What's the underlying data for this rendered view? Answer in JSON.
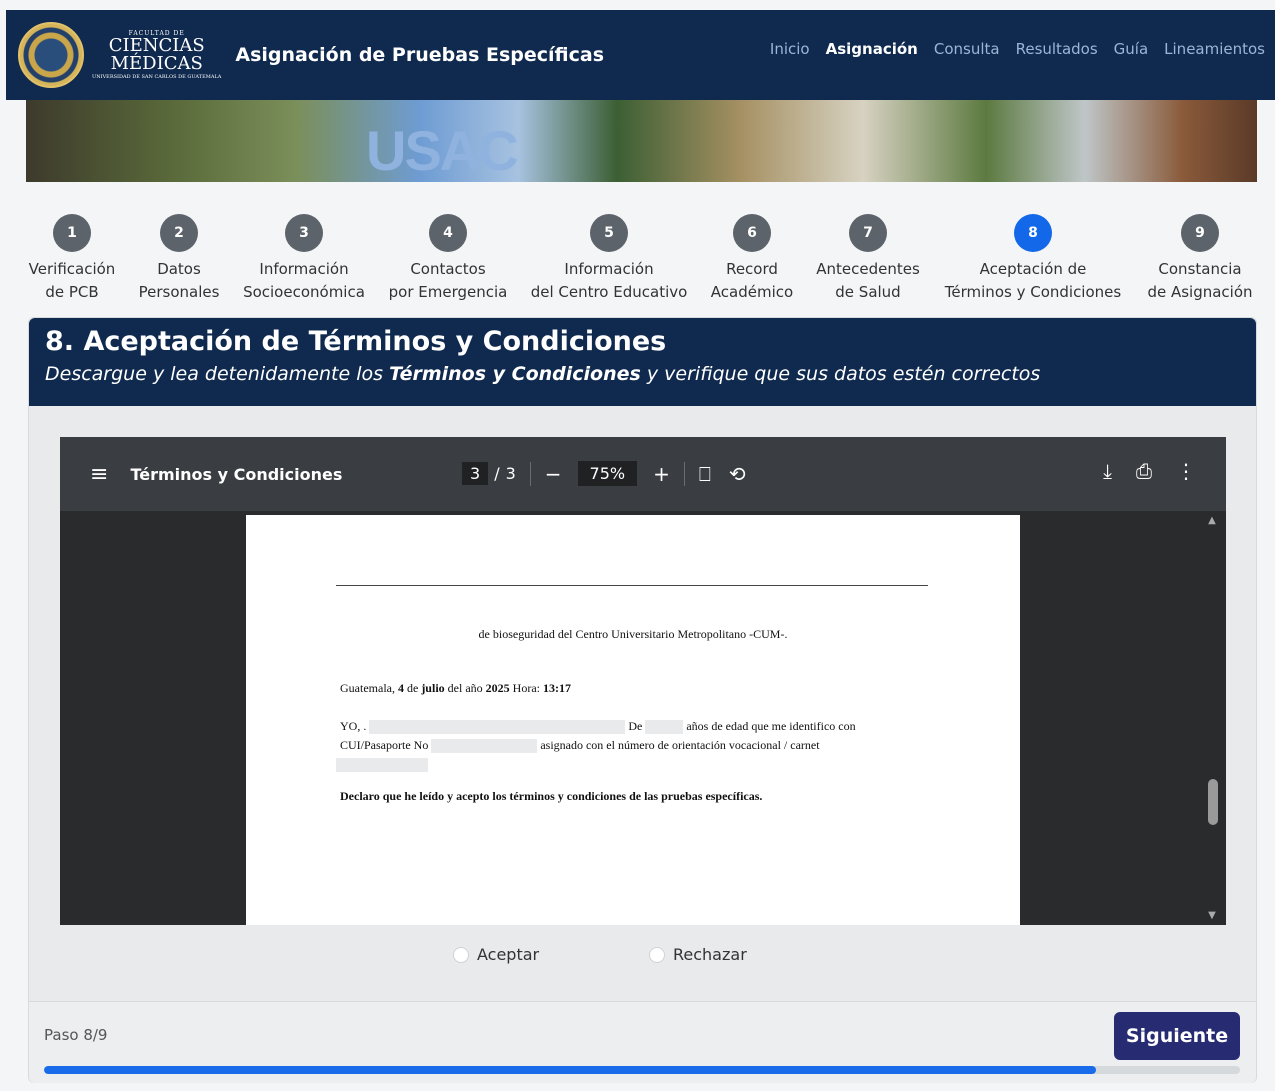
{
  "header": {
    "logo_small": "FACULTAD DE",
    "logo_line1": "CIENCIAS",
    "logo_line2": "MÉDICAS",
    "logo_tiny": "UNIVERSIDAD DE SAN CARLOS DE GUATEMALA",
    "title": "Asignación de Pruebas Específicas",
    "nav": [
      {
        "label": "Inicio",
        "active": false
      },
      {
        "label": "Asignación",
        "active": true
      },
      {
        "label": "Consulta",
        "active": false
      },
      {
        "label": "Resultados",
        "active": false
      },
      {
        "label": "Guía",
        "active": false
      },
      {
        "label": "Lineamientos",
        "active": false
      }
    ]
  },
  "banner": {
    "text": "USAC"
  },
  "steps": [
    {
      "num": "1",
      "line1": "Verificación",
      "line2": "de PCB"
    },
    {
      "num": "2",
      "line1": "Datos",
      "line2": "Personales"
    },
    {
      "num": "3",
      "line1": "Información",
      "line2": "Socioeconómica"
    },
    {
      "num": "4",
      "line1": "Contactos",
      "line2": "por Emergencia"
    },
    {
      "num": "5",
      "line1": "Información",
      "line2": "del Centro Educativo"
    },
    {
      "num": "6",
      "line1": "Record",
      "line2": "Académico"
    },
    {
      "num": "7",
      "line1": "Antecedentes",
      "line2": "de Salud"
    },
    {
      "num": "8",
      "line1": "Aceptación de",
      "line2": "Términos y Condiciones"
    },
    {
      "num": "9",
      "line1": "Constancia",
      "line2": "de Asignación"
    }
  ],
  "current_step": 8,
  "card": {
    "title": "8. Aceptación de Términos y Condiciones",
    "subtitle_pre": "Descargue y lea detenidamente los ",
    "subtitle_bold": "Términos y Condiciones",
    "subtitle_post": " y verifique que sus datos estén correctos"
  },
  "pdf": {
    "menu_icon": "hamburger-menu-icon",
    "title": "Términos y Condiciones",
    "page_current": "3",
    "page_sep": "/",
    "page_total": "3",
    "zoom_out": "−",
    "zoom": "75%",
    "zoom_in": "+",
    "fit_icon": "fit-page-icon",
    "rotate_icon": "rotate-icon",
    "download_icon": "download-icon",
    "print_icon": "print-icon",
    "more_icon": "more-vertical-icon",
    "line1": "de bioseguridad del Centro Universitario Metropolitano -CUM-.",
    "date_pre": "Guatemala, ",
    "date_day": "4",
    "date_mid1": " de ",
    "date_month": "julio",
    "date_mid2": " del año ",
    "date_year": "2025",
    "date_mid3": " Hora: ",
    "date_time": "13:17",
    "yo_pre": "YO, .",
    "yo_de": "De",
    "yo_post": "años de edad que me identifico con",
    "cui_pre": "CUI/Pasaporte No",
    "cui_post": "asignado con el número de orientación vocacional / carnet",
    "declaration": "Declaro que he leído y acepto los términos y condiciones de las pruebas específicas."
  },
  "options": {
    "accept": "Aceptar",
    "reject": "Rechazar"
  },
  "footer": {
    "step_text": "Paso 8/9",
    "next_label": "Siguiente",
    "progress": 0.88
  },
  "colors": {
    "navy": "#0f2a4e",
    "active_step": "#1268e8",
    "button": "#262b72",
    "progress": "#1a6bea"
  }
}
